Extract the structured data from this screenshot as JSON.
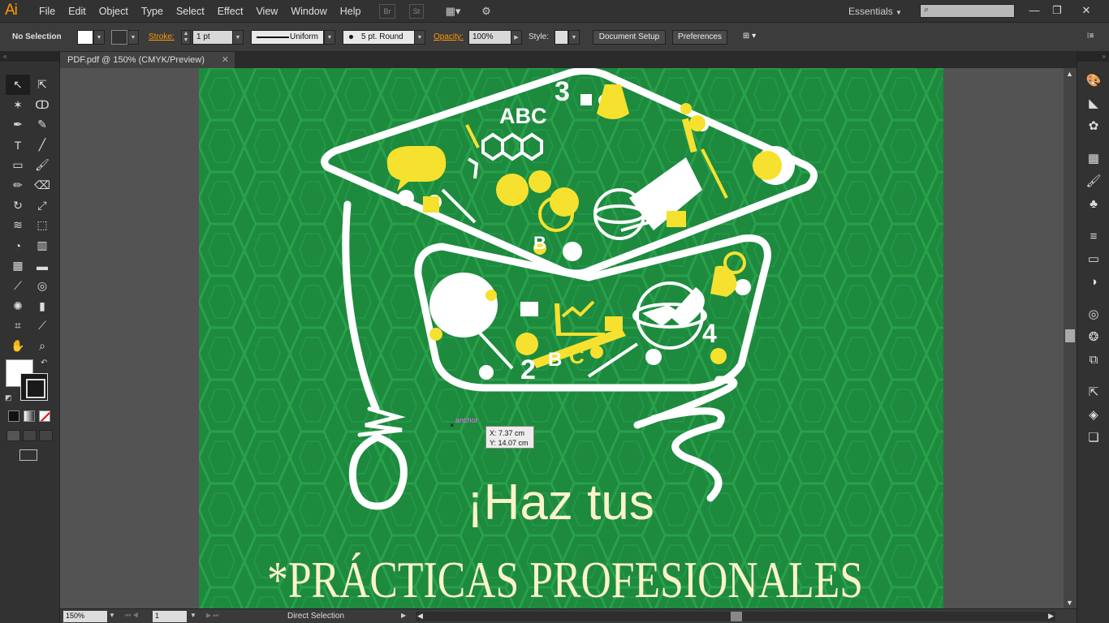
{
  "app": {
    "logo": "Ai"
  },
  "menu": [
    "File",
    "Edit",
    "Object",
    "Type",
    "Select",
    "Effect",
    "View",
    "Window",
    "Help"
  ],
  "menu_buttons": {
    "bridge": "Br",
    "stock": "St"
  },
  "workspace": {
    "label": "Essentials",
    "search_placeholder": ""
  },
  "window_controls": {
    "minimize": "—",
    "restore": "❐",
    "close": "✕"
  },
  "control_bar": {
    "selection": "No Selection",
    "stroke_label": "Stroke:",
    "stroke_weight": "1 pt",
    "profile": "Uniform",
    "brush": "5 pt. Round",
    "opacity_label": "Opacity:",
    "opacity_value": "100%",
    "style_label": "Style:",
    "document_setup": "Document Setup",
    "preferences": "Preferences"
  },
  "document": {
    "tab_title": "PDF.pdf @ 150% (CMYK/Preview)",
    "close": "✕"
  },
  "status_bar": {
    "zoom": "150%",
    "page": "1",
    "tool": "Direct Selection"
  },
  "cursor": {
    "label": "anchor",
    "x": "X: 7.37 cm",
    "y": "Y: 14.07 cm"
  },
  "artwork": {
    "headline": "¡Haz tus",
    "subline": "*Prácticas Profesionales",
    "cap_texts": [
      "ABC",
      "3",
      "B",
      "2",
      "B",
      "C",
      "4"
    ],
    "colors": {
      "background": "#1d8a3e",
      "pattern": "#27a14b",
      "white": "#ffffff",
      "yellow": "#f6e12f",
      "cream": "#fbf3c9"
    }
  },
  "colors": {
    "accent": "#ff9a00",
    "ui_dark": "#323232",
    "canvas": "#535353"
  }
}
